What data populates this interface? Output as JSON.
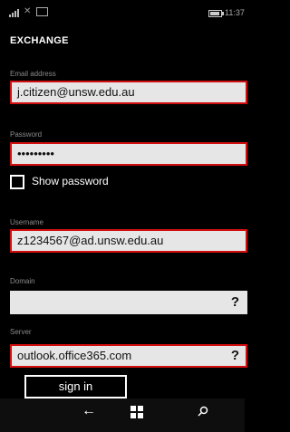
{
  "status_bar": {
    "time": "11:37"
  },
  "screen": {
    "title": "EXCHANGE"
  },
  "form": {
    "email": {
      "label": "Email address",
      "value": "j.citizen@unsw.edu.au"
    },
    "password": {
      "label": "Password",
      "value": "•••••••••"
    },
    "show_password": {
      "label": "Show password",
      "checked": false
    },
    "username": {
      "label": "Username",
      "value": "z1234567@ad.unsw.edu.au"
    },
    "domain": {
      "label": "Domain",
      "value": "",
      "help": "?"
    },
    "server": {
      "label": "Server",
      "value": "outlook.office365.com",
      "help": "?"
    }
  },
  "actions": {
    "sign_in": "sign in"
  },
  "nav_bar": {
    "icons": [
      "back-arrow-icon",
      "windows-start-icon",
      "search-icon"
    ]
  },
  "colors": {
    "highlight": "#d20f0f",
    "field_bg": "#e6e6e6",
    "background": "#000000"
  }
}
